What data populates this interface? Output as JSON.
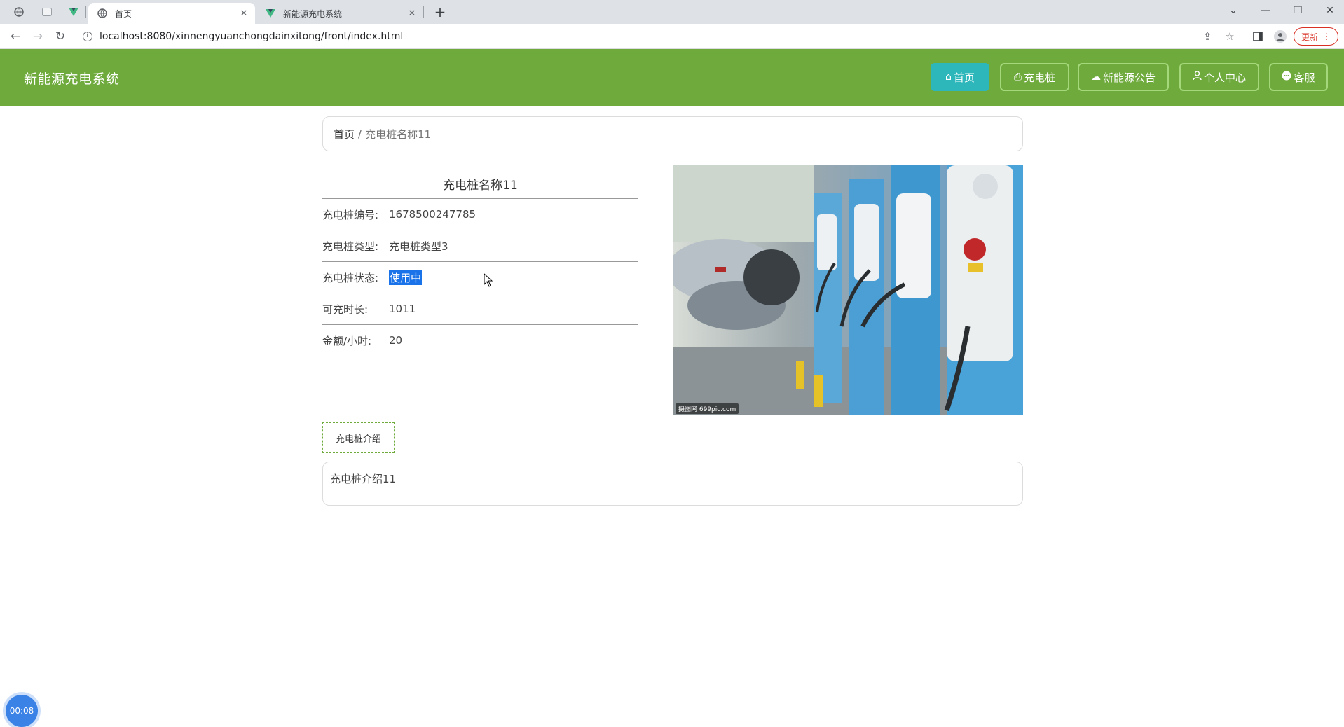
{
  "browser": {
    "tabs": [
      {
        "title": "首页",
        "favicon": "globe-icon",
        "active": true
      },
      {
        "title": "新能源充电系统",
        "favicon": "vue-icon",
        "active": false
      }
    ],
    "url": "localhost:8080/xinnengyuanchongdainxitong/front/index.html",
    "update_label": "更新"
  },
  "header": {
    "brand": "新能源充电系统",
    "nav": [
      {
        "label": "首页",
        "icon": "home-icon",
        "active": true
      },
      {
        "label": "充电桩",
        "icon": "printer-icon",
        "active": false
      },
      {
        "label": "新能源公告",
        "icon": "cloud-icon",
        "active": false
      },
      {
        "label": "个人中心",
        "icon": "user-icon",
        "active": false
      },
      {
        "label": "客服",
        "icon": "chat-icon",
        "active": false
      }
    ]
  },
  "breadcrumb": {
    "home": "首页",
    "separator": "/",
    "current": "充电桩名称11"
  },
  "detail": {
    "title": "充电桩名称11",
    "fields": [
      {
        "label": "充电桩编号:",
        "value": "1678500247785"
      },
      {
        "label": "充电桩类型:",
        "value": "充电桩类型3"
      },
      {
        "label": "充电桩状态:",
        "value": "使用中"
      },
      {
        "label": "可充时长:",
        "value": "1011"
      },
      {
        "label": "金额/小时:",
        "value": "20"
      }
    ],
    "image_watermark": "摄图网 699pic.com"
  },
  "intro": {
    "tab_label": "充电桩介绍",
    "content": "充电桩介绍11"
  },
  "timer": "00:08",
  "colors": {
    "header": "#6faa3d",
    "active_nav": "#2db7ba",
    "selection": "#1a73e8"
  }
}
